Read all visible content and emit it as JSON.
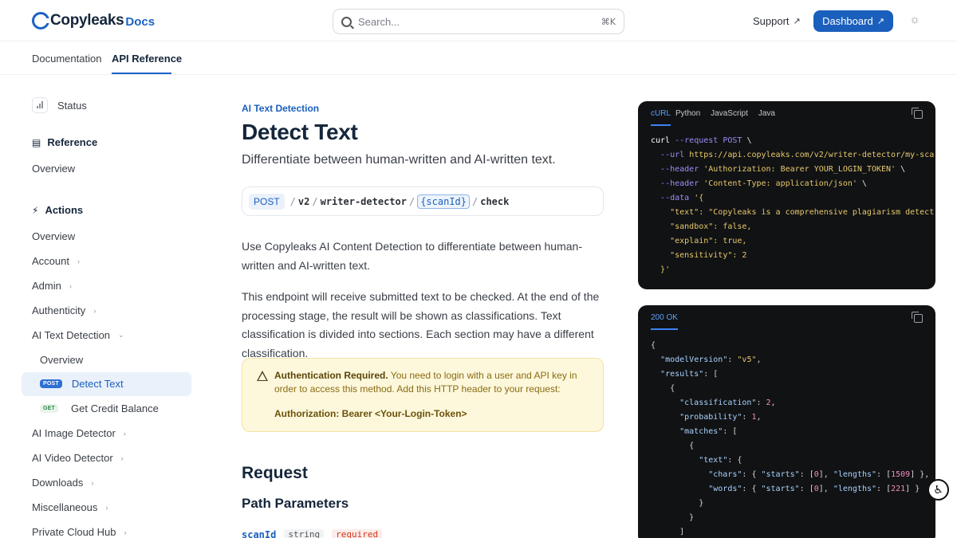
{
  "header": {
    "logo_text": "Copyleaks",
    "logo_suffix": "Docs",
    "search_placeholder": "Search...",
    "search_shortcut": "⌘K",
    "support_label": "Support",
    "dashboard_label": "Dashboard"
  },
  "subnav": {
    "tabs": [
      {
        "label": "Documentation"
      },
      {
        "label": "API Reference"
      }
    ]
  },
  "sidebar": {
    "status": "Status",
    "reference_heading": "Reference",
    "reference_overview": "Overview",
    "actions_heading": "Actions",
    "items": [
      {
        "label": "Overview"
      },
      {
        "label": "Account"
      },
      {
        "label": "Admin"
      },
      {
        "label": "Authenticity"
      },
      {
        "label": "AI Text Detection"
      },
      {
        "label": "Overview"
      },
      {
        "label": "Detect Text",
        "method": "POST"
      },
      {
        "label": "Get Credit Balance",
        "method": "GET"
      },
      {
        "label": "AI Image Detector"
      },
      {
        "label": "AI Video Detector"
      },
      {
        "label": "Downloads"
      },
      {
        "label": "Miscellaneous"
      },
      {
        "label": "Private Cloud Hub"
      }
    ]
  },
  "main": {
    "category": "AI Text Detection",
    "title": "Detect Text",
    "subtitle": "Differentiate between human-written and AI-written text.",
    "endpoint": {
      "method": "POST",
      "segments": [
        "v2",
        "writer-detector",
        "{scanId}",
        "check"
      ]
    },
    "para1": "Use Copyleaks AI Content Detection to differentiate between human-written and AI-written text.",
    "para2": "This endpoint will receive submitted text to be checked. At the end of the processing stage, the result will be shown as classifications. Text classification is divided into sections. Each section may have a different classification.",
    "callout": {
      "title": "Authentication Required.",
      "body": "You need to login with a user and API key in order to access this method. Add this HTTP header to your request:",
      "code": "Authorization: Bearer <Your-Login-Token>"
    },
    "request_heading": "Request",
    "path_params_heading": "Path Parameters",
    "param": {
      "name": "scanId",
      "type": "string",
      "required": "required"
    }
  },
  "code_request": {
    "tabs": [
      "cURL",
      "Python",
      "JavaScript",
      "Java"
    ],
    "active_tab": "cURL"
  },
  "code_response": {
    "tabs": [
      "200 OK"
    ],
    "active_tab": "200 OK"
  }
}
